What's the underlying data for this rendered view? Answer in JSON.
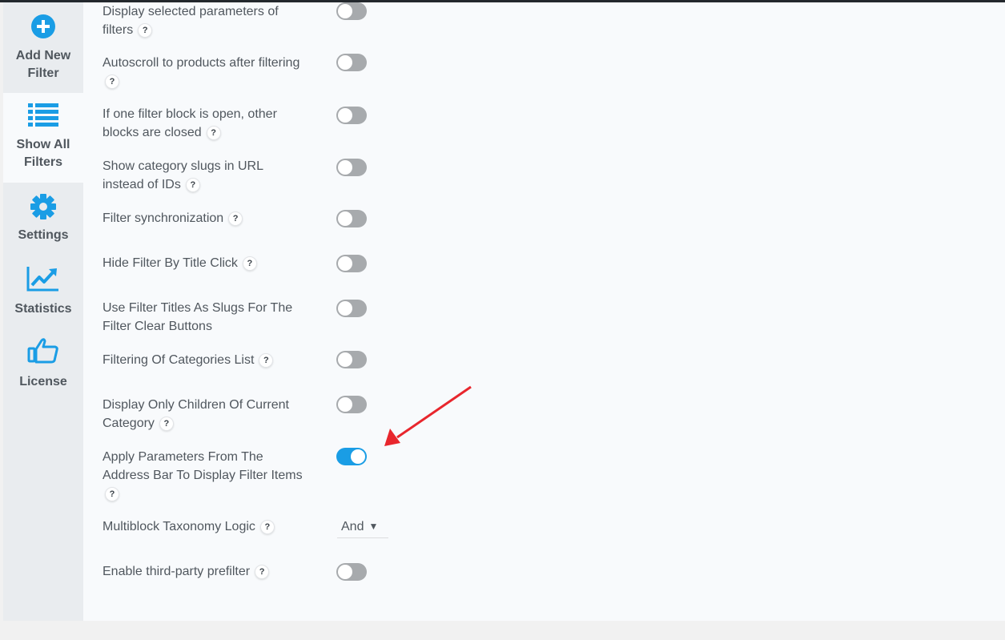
{
  "sidebar": {
    "items": [
      {
        "label_line1": "Add New",
        "label_line2": "Filter",
        "icon": "plus-circle-icon"
      },
      {
        "label_line1": "Show All",
        "label_line2": "Filters",
        "icon": "list-icon"
      },
      {
        "label_line1": "Settings",
        "icon": "gear-icon"
      },
      {
        "label_line1": "Statistics",
        "icon": "chart-line-icon"
      },
      {
        "label_line1": "License",
        "icon": "thumbs-up-icon"
      }
    ]
  },
  "settings": {
    "help_mark": "?",
    "rows": [
      {
        "line1": "Display selected parameters of",
        "line2": "filters",
        "enabled": false
      },
      {
        "line1": "Autoscroll to products after filtering",
        "line2": "",
        "enabled": false
      },
      {
        "line1": "If one filter block is open, other",
        "line2": "blocks are closed",
        "enabled": false
      },
      {
        "line1": "Show category slugs in URL",
        "line2": "instead of IDs",
        "enabled": false
      },
      {
        "line1": "Filter synchronization",
        "enabled": false
      },
      {
        "line1": "Hide Filter By Title Click",
        "enabled": false
      },
      {
        "line1": "Use Filter Titles As Slugs For The",
        "line2": "Filter Clear Buttons",
        "enabled": false
      },
      {
        "line1": "Filtering Of Categories List",
        "enabled": false
      },
      {
        "line1": "Display Only Children Of Current",
        "line2": "Category",
        "enabled": false
      },
      {
        "line1": "Apply Parameters From The",
        "line2": "Address Bar To Display Filter Items",
        "enabled": true
      },
      {
        "line1": "Multiblock Taxonomy Logic",
        "select_value": "And"
      },
      {
        "line1": "Enable third-party prefilter",
        "enabled": false
      }
    ]
  },
  "colors": {
    "accent": "#1a9de5",
    "annotation_arrow": "#e8262d"
  }
}
